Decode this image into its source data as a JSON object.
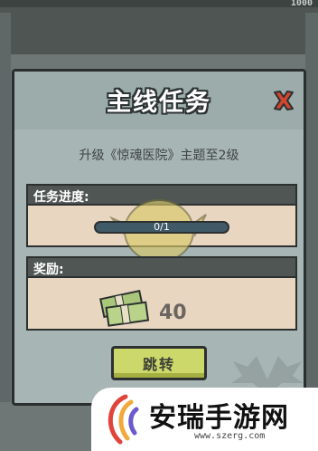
{
  "background": {
    "counter": "1000"
  },
  "dialog": {
    "title": "主线任务",
    "close_icon": "close-x-icon",
    "subtitle": "升级《惊魂医院》主题至2级",
    "progress_section": {
      "label": "任务进度:",
      "progress_text": "0/1",
      "current": 0,
      "target": 1
    },
    "reward_section": {
      "label": "奖励:",
      "reward_icon": "cash-stack-icon",
      "amount": "40"
    },
    "jump_button": {
      "label": "跳转"
    }
  },
  "watermark": {
    "name": "安瑞手游网",
    "url": "www.szerg.com"
  },
  "colors": {
    "dialog_bg": "#a7b5b4",
    "section_bar": "#4f5654",
    "section_body": "#e9d6c0",
    "close_red": "#d0452f",
    "button_green": "#ccd86a"
  }
}
